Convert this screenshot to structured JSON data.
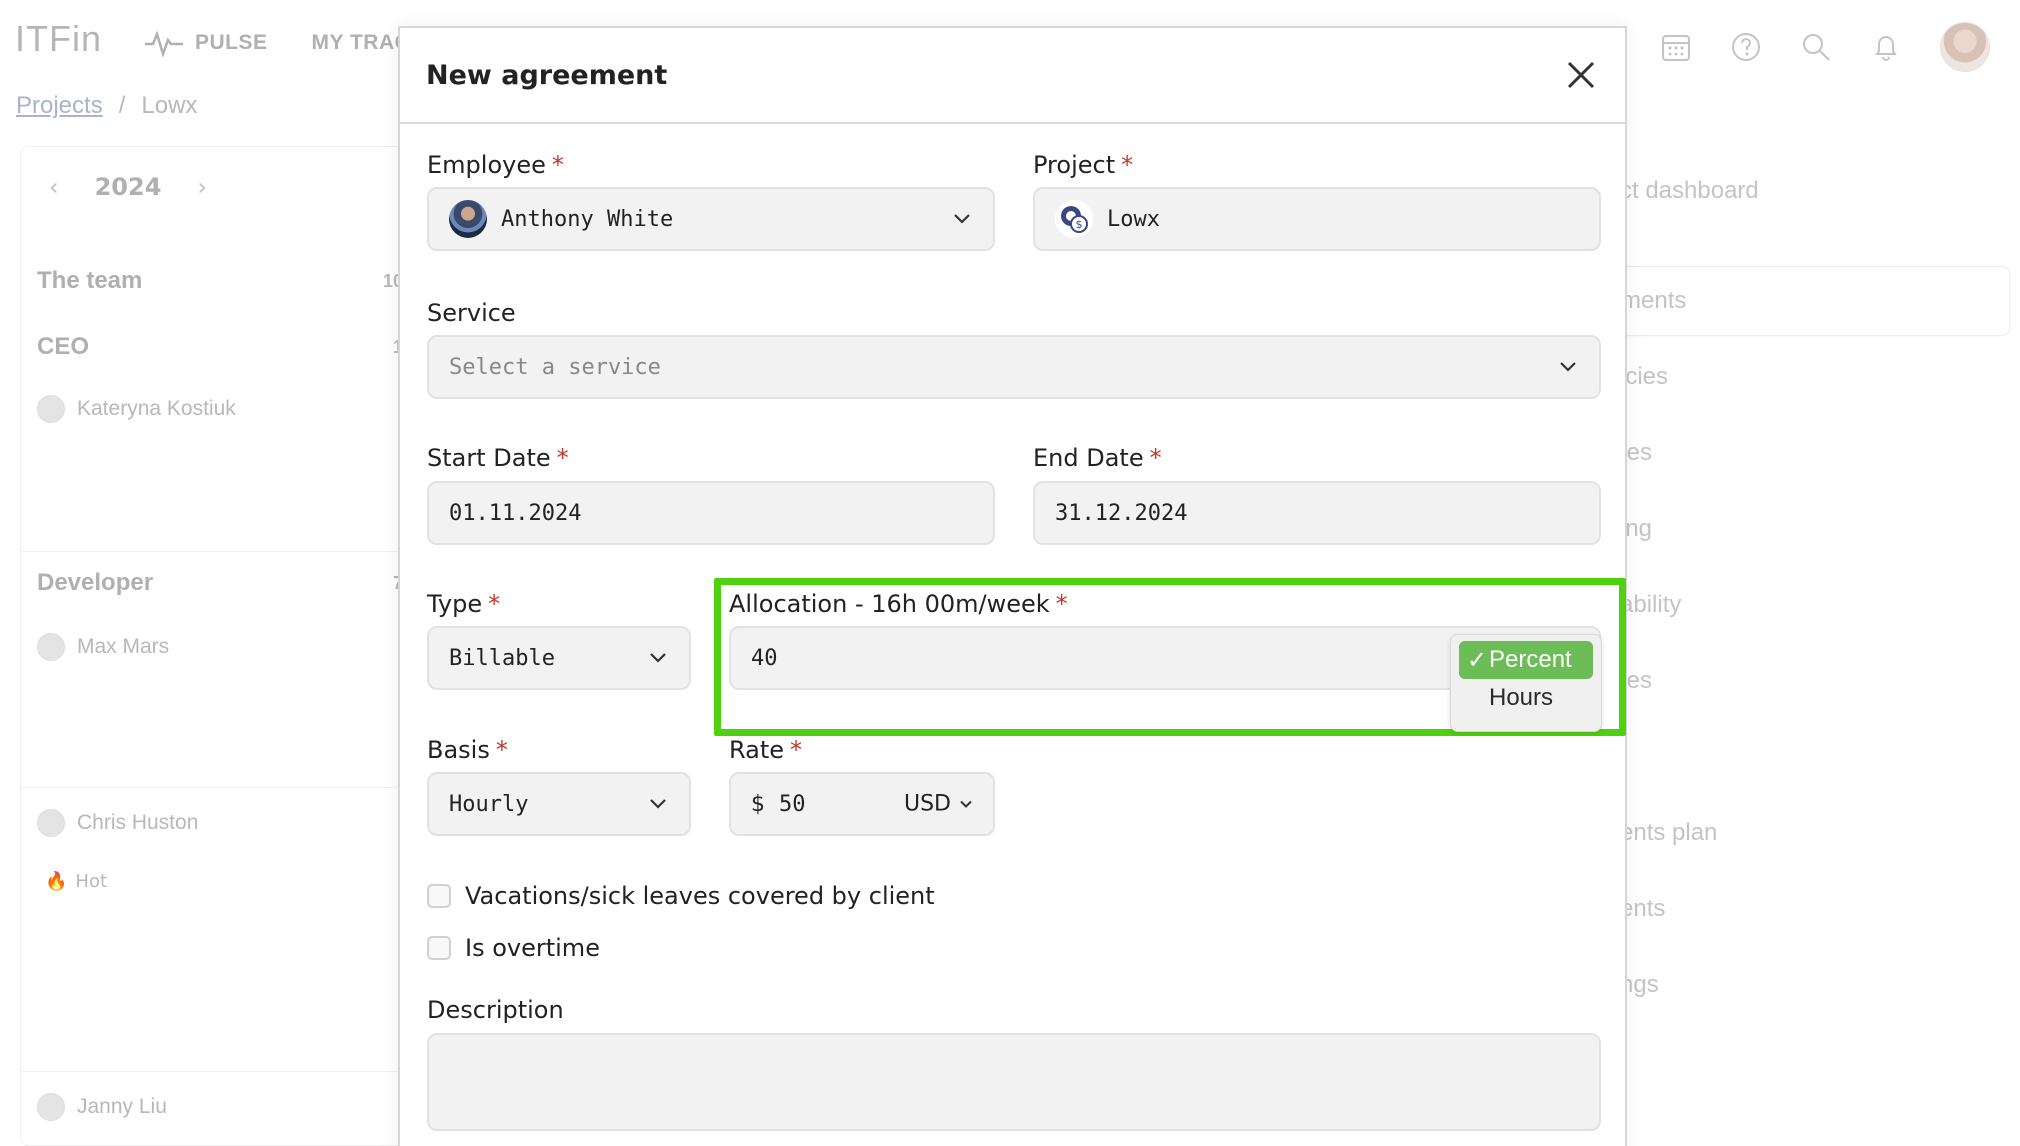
{
  "app": {
    "logo": "ITFin",
    "nav": [
      {
        "label": "PULSE",
        "icon": "pulse-icon"
      },
      {
        "label": "MY TRACKER",
        "icon": ""
      }
    ],
    "top_icons": [
      "calendar-icon",
      "help-icon",
      "search-icon",
      "bell-icon",
      "user-avatar"
    ]
  },
  "breadcrumb": {
    "parent": "Projects",
    "separator": "/",
    "current": "Lowx"
  },
  "left_panel": {
    "year": "2024",
    "team_label": "The team",
    "team_count": "10",
    "groups": [
      {
        "role": "CEO",
        "count": "1",
        "members": [
          "Kateryna Kostiuk"
        ]
      },
      {
        "role": "Developer",
        "count": "7",
        "members": [
          "Max Mars",
          "Chris Huston",
          "Janny Liu"
        ]
      }
    ],
    "hot_label": "Hot"
  },
  "right_panel": {
    "items": [
      {
        "label": "ct dashboard"
      },
      {
        "label": "ments"
      },
      {
        "label": "icies"
      },
      {
        "label": "tes"
      },
      {
        "label": "ing"
      },
      {
        "label": "ability"
      },
      {
        "label": "tes"
      },
      {
        "label": ""
      },
      {
        "label": "ents plan"
      },
      {
        "label": "ents"
      },
      {
        "label": "ngs"
      }
    ]
  },
  "modal": {
    "title": "New agreement",
    "employee": {
      "label": "Employee",
      "required": "*",
      "value": "Anthony White"
    },
    "project": {
      "label": "Project",
      "required": "*",
      "value": "Lowx"
    },
    "service": {
      "label": "Service",
      "placeholder": "Select a service"
    },
    "start_date": {
      "label": "Start Date",
      "required": "*",
      "value": "01.11.2024"
    },
    "end_date": {
      "label": "End Date",
      "required": "*",
      "value": "31.12.2024"
    },
    "type": {
      "label": "Type",
      "required": "*",
      "value": "Billable"
    },
    "allocation": {
      "label": "Allocation - 16h 00m/week",
      "required": "*",
      "value": "40",
      "unit_options": [
        {
          "label": "Percent",
          "selected": true,
          "check": "✓"
        },
        {
          "label": "Hours",
          "selected": false
        }
      ]
    },
    "basis": {
      "label": "Basis",
      "required": "*",
      "value": "Hourly"
    },
    "rate": {
      "label": "Rate",
      "required": "*",
      "currency_symbol": "$",
      "value": "50",
      "currency": "USD"
    },
    "checkboxes": [
      {
        "label": "Vacations/sick leaves covered by client",
        "checked": false
      },
      {
        "label": "Is overtime",
        "checked": false
      }
    ],
    "description": {
      "label": "Description",
      "value": ""
    }
  },
  "colors": {
    "highlight": "#4fd10f",
    "selected_option": "#6cbd58",
    "required": "#c0392b"
  }
}
